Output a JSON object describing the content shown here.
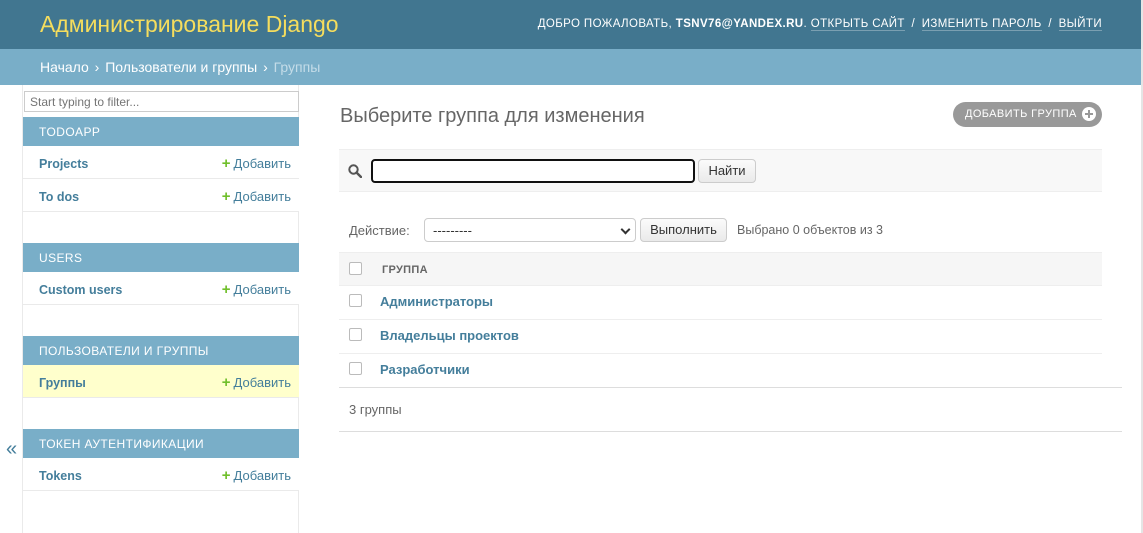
{
  "header": {
    "brand": "Администрирование Django",
    "welcome": "ДОБРО ПОЖАЛОВАТЬ,",
    "username": "TSNV76@YANDEX.RU",
    "period": ".",
    "view_site": "ОТКРЫТЬ САЙТ",
    "change_password": "ИЗМЕНИТЬ ПАРОЛЬ",
    "logout": "ВЫЙТИ",
    "separator": "/"
  },
  "breadcrumbs": {
    "home": "Начало",
    "app": "Пользователи и группы",
    "current": "Группы",
    "arrow": "›"
  },
  "sidebar": {
    "filter_placeholder": "Start typing to filter...",
    "add_label": "Добавить",
    "modules": [
      {
        "caption": "TODOAPP",
        "models": [
          {
            "name": "Projects"
          },
          {
            "name": "To dos"
          }
        ]
      },
      {
        "caption": "USERS",
        "models": [
          {
            "name": "Custom users"
          }
        ]
      },
      {
        "caption": "ПОЛЬЗОВАТЕЛИ И ГРУППЫ",
        "models": [
          {
            "name": "Группы"
          }
        ]
      },
      {
        "caption": "ТОКЕН АУТЕНТИФИКАЦИИ",
        "models": [
          {
            "name": "Tokens"
          }
        ]
      }
    ],
    "toggle": "«"
  },
  "content": {
    "title": "Выберите группа для изменения",
    "add_button": "ДОБАВИТЬ ГРУППА",
    "search_value": "",
    "search_button": "Найти",
    "action_label": "Действие:",
    "action_selected": "---------",
    "action_go": "Выполнить",
    "action_counter": "Выбрано 0 объектов из 3",
    "column_header": "ГРУППА",
    "rows": [
      "Администраторы",
      "Владельцы проектов",
      "Разработчики"
    ],
    "paginator": "3 группы"
  }
}
